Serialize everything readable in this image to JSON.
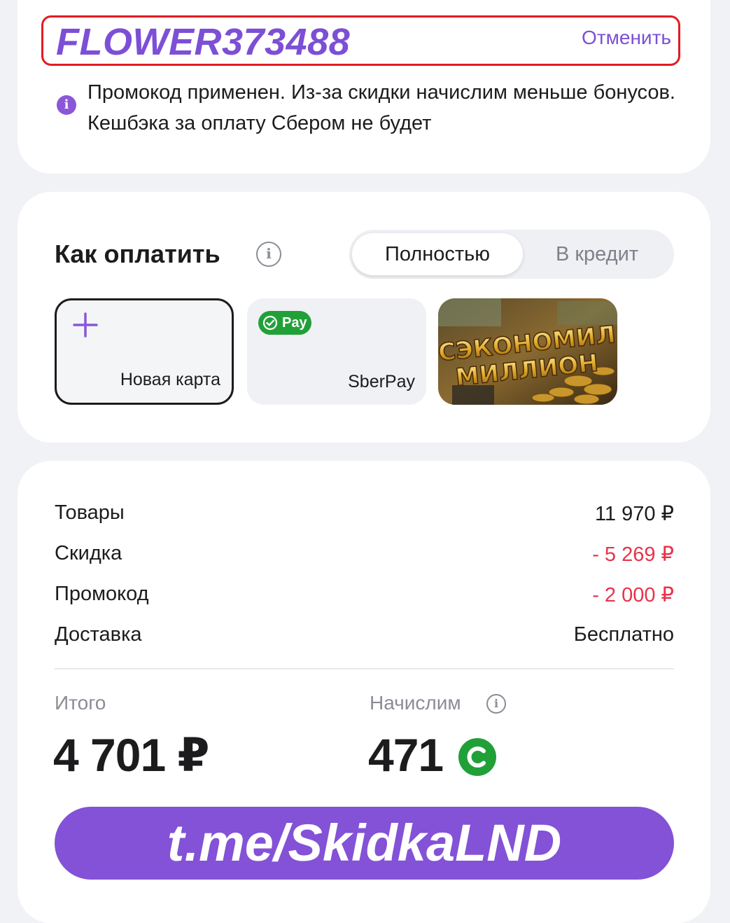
{
  "promo": {
    "code": "FLOWER373488",
    "cancel_label": "Отменить",
    "note": "Промокод применен. Из-за скидки начислим меньше бонусов. Кешбэка за оплату Сбером не будет"
  },
  "payment": {
    "title": "Как оплатить",
    "modes": [
      "Полностью",
      "В кредит"
    ],
    "new_card_label": "Новая карта",
    "sberpay_badge": "Pay",
    "sberpay_label": "SberPay",
    "banner_line1": "СЭКОНОМИЛ",
    "banner_line2": "МИЛЛИОН"
  },
  "summary": {
    "rows": [
      {
        "label": "Товары",
        "value": "11 970 ₽"
      },
      {
        "label": "Скидка",
        "value": "- 5 269 ₽"
      },
      {
        "label": "Промокод",
        "value": "- 2 000 ₽"
      },
      {
        "label": "Доставка",
        "value": "Бесплатно"
      }
    ],
    "total_label": "Итого",
    "total_value": "4 701 ₽",
    "bonus_label": "Начислим",
    "bonus_value": "471",
    "cta_label": "t.me/SkidkaLND"
  },
  "colors": {
    "accent": "#8352d6",
    "promo_border": "#e31b23",
    "negative": "#e8334a",
    "sber_green": "#21a038"
  }
}
